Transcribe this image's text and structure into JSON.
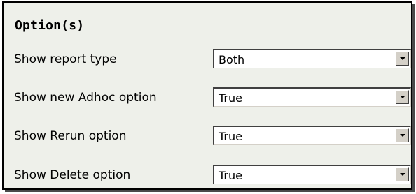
{
  "panel": {
    "title": "Option(s)"
  },
  "options": [
    {
      "label": "Show report type",
      "value": "Both"
    },
    {
      "label": "Show new Adhoc option",
      "value": "True"
    },
    {
      "label": "Show Rerun option",
      "value": "True"
    },
    {
      "label": "Show Delete option",
      "value": "True"
    }
  ],
  "icons": {
    "dropdown": "chevron-down-icon"
  }
}
